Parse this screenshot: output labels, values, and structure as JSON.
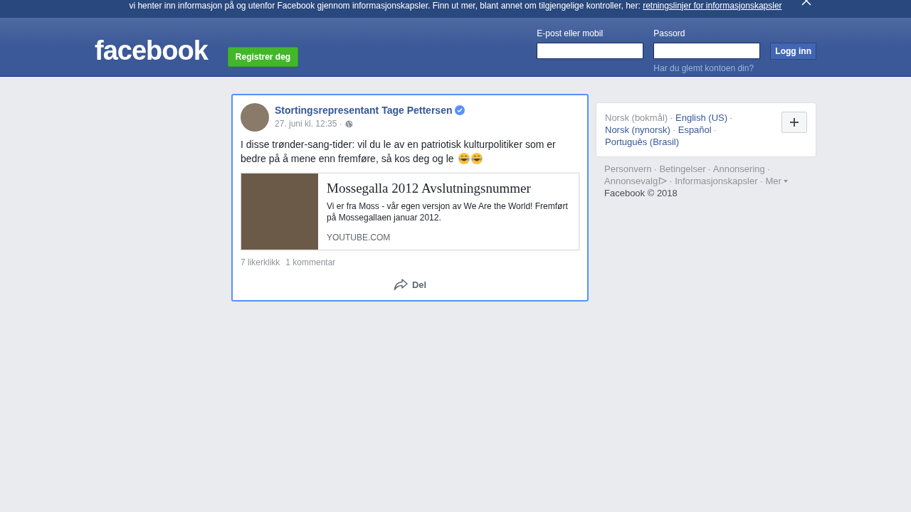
{
  "cookie_banner": {
    "text": "vi henter inn informasjon på og utenfor Facebook gjennom informasjonskapsler. Finn ut mer, blant annet om tilgjengelige kontroller, her: ",
    "link": "retningslinjer for informasjonskapsler"
  },
  "header": {
    "logo": "facebook",
    "register_button": "Registrer deg",
    "email_label": "E-post eller mobil",
    "password_label": "Passord",
    "login_button": "Logg inn",
    "forgot_link": "Har du glemt kontoen din?"
  },
  "post": {
    "focused": true,
    "author": "Stortingsrepresentant Tage Pettersen",
    "verified": true,
    "time": "27. juni kl. 12:35 ·",
    "text": "I disse trønder-sang-tider: vil du le av en patriotisk kulturpolitiker som er bedre på å mene enn fremføre, så kos deg og le",
    "emojis": [
      {
        "kind": "laughing"
      },
      {
        "kind": "laughing"
      }
    ],
    "link_preview": {
      "title": "Mossegalla 2012 Avslutningsnummer",
      "description": "Vi er fra Moss - vår egen versjon av We Are the World! Fremført på Mossegallaen januar 2012.",
      "domain": "YOUTUBE.COM"
    },
    "likes": "7 likerklikk",
    "comments": "1 kommentar",
    "share_button": "Del"
  },
  "languages": [
    {
      "label": "Norsk (bokmål)",
      "selected": true,
      "separator": "·"
    },
    {
      "label": "English (US)",
      "selected": false,
      "separator": "·"
    },
    {
      "label": "Norsk (nynorsk)",
      "selected": false,
      "separator": "·"
    },
    {
      "label": "Español",
      "selected": false,
      "separator": "·"
    },
    {
      "label": "Português (Brasil)",
      "selected": false
    }
  ],
  "footer_links": [
    {
      "label": "Personvern",
      "kind": "plain",
      "separator": "·"
    },
    {
      "label": "Betingelser",
      "kind": "plain",
      "separator": "·"
    },
    {
      "label": "Annonsering",
      "kind": "plain",
      "separator": "·"
    },
    {
      "label": "Annonsevalg",
      "kind": "adchoices",
      "separator": "·"
    },
    {
      "label": "Informasjonskapsler",
      "kind": "plain",
      "separator": "·"
    },
    {
      "label": "Mer",
      "kind": "menu"
    }
  ],
  "copyright": "Facebook © 2018"
}
